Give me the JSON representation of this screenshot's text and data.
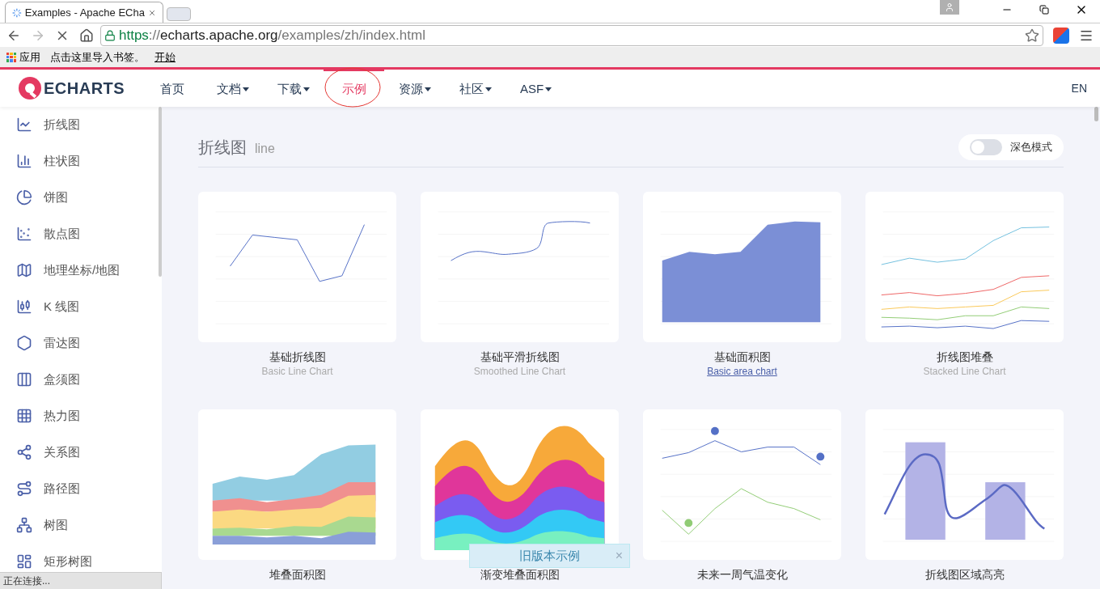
{
  "browser": {
    "tab_title": "Examples - Apache ECha",
    "url": "https://echarts.apache.org/examples/zh/index.html",
    "bookmarks": [
      {
        "label": "应用",
        "kind": "apps"
      },
      {
        "label": "点击这里导入书签。",
        "kind": "text"
      },
      {
        "label": "开始",
        "kind": "link"
      }
    ]
  },
  "nav": {
    "logo_text": "ECHARTS",
    "items": [
      {
        "label": "首页",
        "dropdown": false,
        "selected": false
      },
      {
        "label": "文档",
        "dropdown": true,
        "selected": false
      },
      {
        "label": "下载",
        "dropdown": true,
        "selected": false
      },
      {
        "label": "示例",
        "dropdown": false,
        "selected": true
      },
      {
        "label": "资源",
        "dropdown": true,
        "selected": false
      },
      {
        "label": "社区",
        "dropdown": true,
        "selected": false
      },
      {
        "label": "ASF",
        "dropdown": true,
        "selected": false
      }
    ],
    "language": "EN"
  },
  "sidebar": {
    "items": [
      {
        "label": "折线图"
      },
      {
        "label": "柱状图"
      },
      {
        "label": "饼图"
      },
      {
        "label": "散点图"
      },
      {
        "label": "地理坐标/地图"
      },
      {
        "label": "K 线图"
      },
      {
        "label": "雷达图"
      },
      {
        "label": "盒须图"
      },
      {
        "label": "热力图"
      },
      {
        "label": "关系图"
      },
      {
        "label": "路径图"
      },
      {
        "label": "树图"
      },
      {
        "label": "矩形树图"
      }
    ]
  },
  "section": {
    "title": "折线图",
    "subtitle": "line",
    "dark_mode": {
      "label": "深色模式",
      "on": false
    }
  },
  "cards": [
    {
      "kind": "line",
      "title": "基础折线图",
      "subtitle": "Basic Line Chart",
      "hovered": false
    },
    {
      "kind": "smooth",
      "title": "基础平滑折线图",
      "subtitle": "Smoothed Line Chart",
      "hovered": false
    },
    {
      "kind": "area",
      "title": "基础面积图",
      "subtitle": "Basic area chart",
      "hovered": true
    },
    {
      "kind": "stacked-line",
      "title": "折线图堆叠",
      "subtitle": "Stacked Line Chart",
      "hovered": false
    },
    {
      "kind": "stacked-area",
      "title": "堆叠面积图"
    },
    {
      "kind": "gradient-area",
      "title": "渐变堆叠面积图"
    },
    {
      "kind": "temperature",
      "title": "未来一周气温变化"
    },
    {
      "kind": "highlight",
      "title": "折线图区域高亮"
    }
  ],
  "old_version_popup": {
    "label": "旧版本示例",
    "close": "×"
  },
  "status_bar": "正在连接..."
}
